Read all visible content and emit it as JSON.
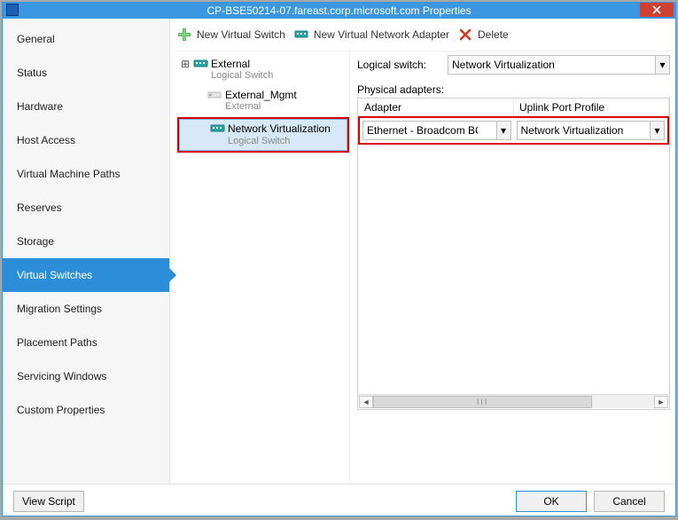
{
  "window": {
    "title": "CP-BSE50214-07.fareast.corp.microsoft.com Properties"
  },
  "sidebar": {
    "items": [
      {
        "label": "General"
      },
      {
        "label": "Status"
      },
      {
        "label": "Hardware"
      },
      {
        "label": "Host Access"
      },
      {
        "label": "Virtual Machine Paths"
      },
      {
        "label": "Reserves"
      },
      {
        "label": "Storage"
      },
      {
        "label": "Virtual Switches"
      },
      {
        "label": "Migration Settings"
      },
      {
        "label": "Placement Paths"
      },
      {
        "label": "Servicing Windows"
      },
      {
        "label": "Custom Properties"
      }
    ],
    "selected_index": 7
  },
  "toolbar": {
    "new_switch": "New Virtual Switch",
    "new_adapter": "New Virtual Network Adapter",
    "delete": "Delete"
  },
  "tree": {
    "nodes": [
      {
        "label": "External",
        "sub": "Logical Switch",
        "expander": "⊞",
        "icon": "switch"
      },
      {
        "label": "External_Mgmt",
        "sub": "External",
        "icon": "adapter"
      },
      {
        "label": "Network Virtualization",
        "sub": "Logical Switch",
        "icon": "switch",
        "selected": true,
        "highlight": true
      }
    ]
  },
  "details": {
    "logical_switch_label": "Logical switch:",
    "logical_switch_value": "Network Virtualization",
    "physical_adapters_label": "Physical adapters:",
    "columns": {
      "adapter": "Adapter",
      "uplink": "Uplink Port Profile"
    },
    "rows": [
      {
        "adapter": "Ethernet - Broadcom BCN",
        "uplink": "Network Virtualization"
      }
    ]
  },
  "footer": {
    "view_script": "View Script",
    "ok": "OK",
    "cancel": "Cancel"
  },
  "icons": {
    "dropdown": "▾",
    "scroll_left": "◄",
    "scroll_right": "►",
    "scroll_grip": "III"
  }
}
